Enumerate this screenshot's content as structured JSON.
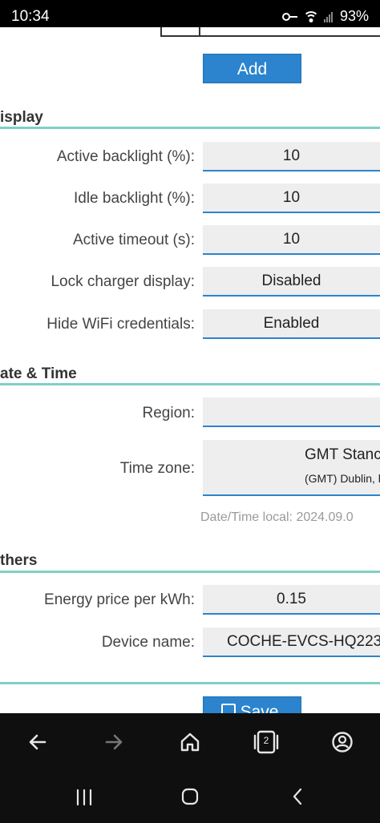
{
  "statusbar": {
    "time": "10:34",
    "battery": "93%"
  },
  "top": {
    "add_label": "Add"
  },
  "display": {
    "title": "isplay",
    "rows": [
      {
        "label": "Active backlight (%):",
        "value": "10"
      },
      {
        "label": "Idle backlight (%):",
        "value": "10"
      },
      {
        "label": "Active timeout (s):",
        "value": "10"
      },
      {
        "label": "Lock charger display:",
        "value": "Disabled"
      },
      {
        "label": "Hide WiFi credentials:",
        "value": "Enabled"
      }
    ]
  },
  "datetime": {
    "title": "ate & Time",
    "region_label": "Region:",
    "region_value": "",
    "timezone_label": "Time zone:",
    "timezone_value": "GMT Stanc",
    "timezone_sub": "(GMT) Dublin, l",
    "local_note": "Date/Time local: 2024.09.0"
  },
  "others": {
    "title": "thers",
    "energy_label": "Energy price per kWh:",
    "energy_value": "0.15",
    "device_label": "Device name:",
    "device_value": "COCHE-EVCS-HQ223"
  },
  "save_label": "Save",
  "toolbar": {
    "tab_count": "2"
  },
  "colors": {
    "accent": "#2b84cd",
    "section_line": "#7ed1c6"
  }
}
